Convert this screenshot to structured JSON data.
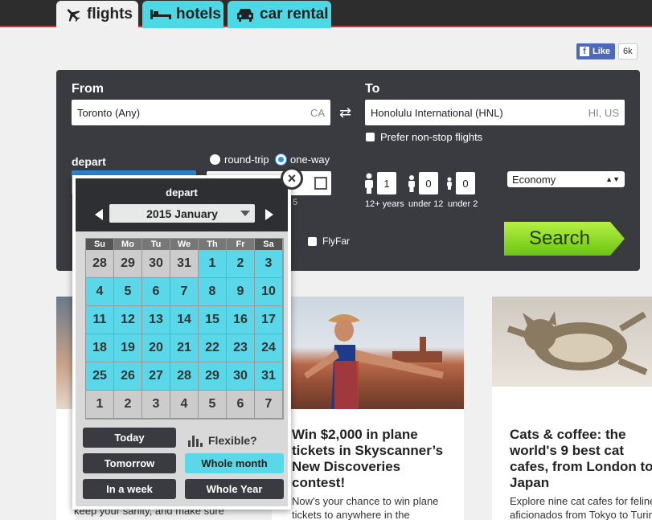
{
  "tabs": [
    {
      "label": "flights",
      "icon": "plane-icon"
    },
    {
      "label": "hotels",
      "icon": "bed-icon"
    },
    {
      "label": "car rental",
      "icon": "car-icon"
    }
  ],
  "facebook": {
    "label": "Like",
    "count": "6k"
  },
  "search": {
    "from_label": "From",
    "from_value": "Toronto (Any)",
    "from_code": "CA",
    "to_label": "To",
    "to_value": "Honolulu International (HNL)",
    "to_code": "HI, US",
    "nonstop_label": "Prefer non-stop flights",
    "depart_label": "depart",
    "trip_round": "round-trip",
    "trip_oneway": "one-way",
    "trip_selected": "one-way",
    "flyfar_label": "FlyFar",
    "passengers": [
      {
        "count": "1",
        "label": "12+ years"
      },
      {
        "count": "0",
        "label": "under 12"
      },
      {
        "count": "0",
        "label": "under 2"
      }
    ],
    "cabin": "Economy",
    "search_button": "Search",
    "partial_text": "5"
  },
  "calendar": {
    "title": "depart",
    "month": "2015 January",
    "weekdays": [
      "Su",
      "Mo",
      "Tu",
      "We",
      "Th",
      "Fr",
      "Sa"
    ],
    "weeks": [
      [
        [
          "28",
          0
        ],
        [
          "29",
          0
        ],
        [
          "30",
          0
        ],
        [
          "31",
          0
        ],
        [
          "1",
          1
        ],
        [
          "2",
          1
        ],
        [
          "3",
          1
        ]
      ],
      [
        [
          "4",
          1
        ],
        [
          "5",
          1
        ],
        [
          "6",
          1
        ],
        [
          "7",
          1
        ],
        [
          "8",
          1
        ],
        [
          "9",
          1
        ],
        [
          "10",
          1
        ]
      ],
      [
        [
          "11",
          1
        ],
        [
          "12",
          1
        ],
        [
          "13",
          1
        ],
        [
          "14",
          1
        ],
        [
          "15",
          1
        ],
        [
          "16",
          1
        ],
        [
          "17",
          1
        ]
      ],
      [
        [
          "18",
          1
        ],
        [
          "19",
          1
        ],
        [
          "20",
          1
        ],
        [
          "21",
          1
        ],
        [
          "22",
          1
        ],
        [
          "23",
          1
        ],
        [
          "24",
          1
        ]
      ],
      [
        [
          "25",
          1
        ],
        [
          "26",
          1
        ],
        [
          "27",
          1
        ],
        [
          "28",
          1
        ],
        [
          "29",
          1
        ],
        [
          "30",
          1
        ],
        [
          "31",
          1
        ]
      ],
      [
        [
          "1",
          0
        ],
        [
          "2",
          0
        ],
        [
          "3",
          0
        ],
        [
          "4",
          0
        ],
        [
          "5",
          0
        ],
        [
          "6",
          0
        ],
        [
          "7",
          0
        ]
      ]
    ],
    "today": "Today",
    "tomorrow": "Tomorrow",
    "in_a_week": "In a week",
    "flexible": "Flexible?",
    "whole_month": "Whole month",
    "whole_year": "Whole Year",
    "close": "×"
  },
  "articles": {
    "left_text": "keep your sanity, and make sure",
    "mid_title": "Win $2,000 in plane tickets in Skyscanner's New Discoveries contest!",
    "mid_title_lines": [
      "Win $2,000 in plane",
      "tickets in Skyscanner’s",
      "New Discoveries",
      "contest!"
    ],
    "mid_body_lines": [
      "Now's your chance to win plane",
      "tickets to anywhere in the"
    ],
    "right_title_lines": [
      "Cats & coffee: the",
      "world's 9 best cat",
      "cafes, from London to",
      "Japan"
    ],
    "right_body_lines": [
      "Explore nine cat cafes for feline",
      "aficionados from Tokyo to Turin"
    ]
  },
  "colors": {
    "accent": "#4dd8e6",
    "search_green": "#7dd21f",
    "panel": "#3a3b40"
  }
}
